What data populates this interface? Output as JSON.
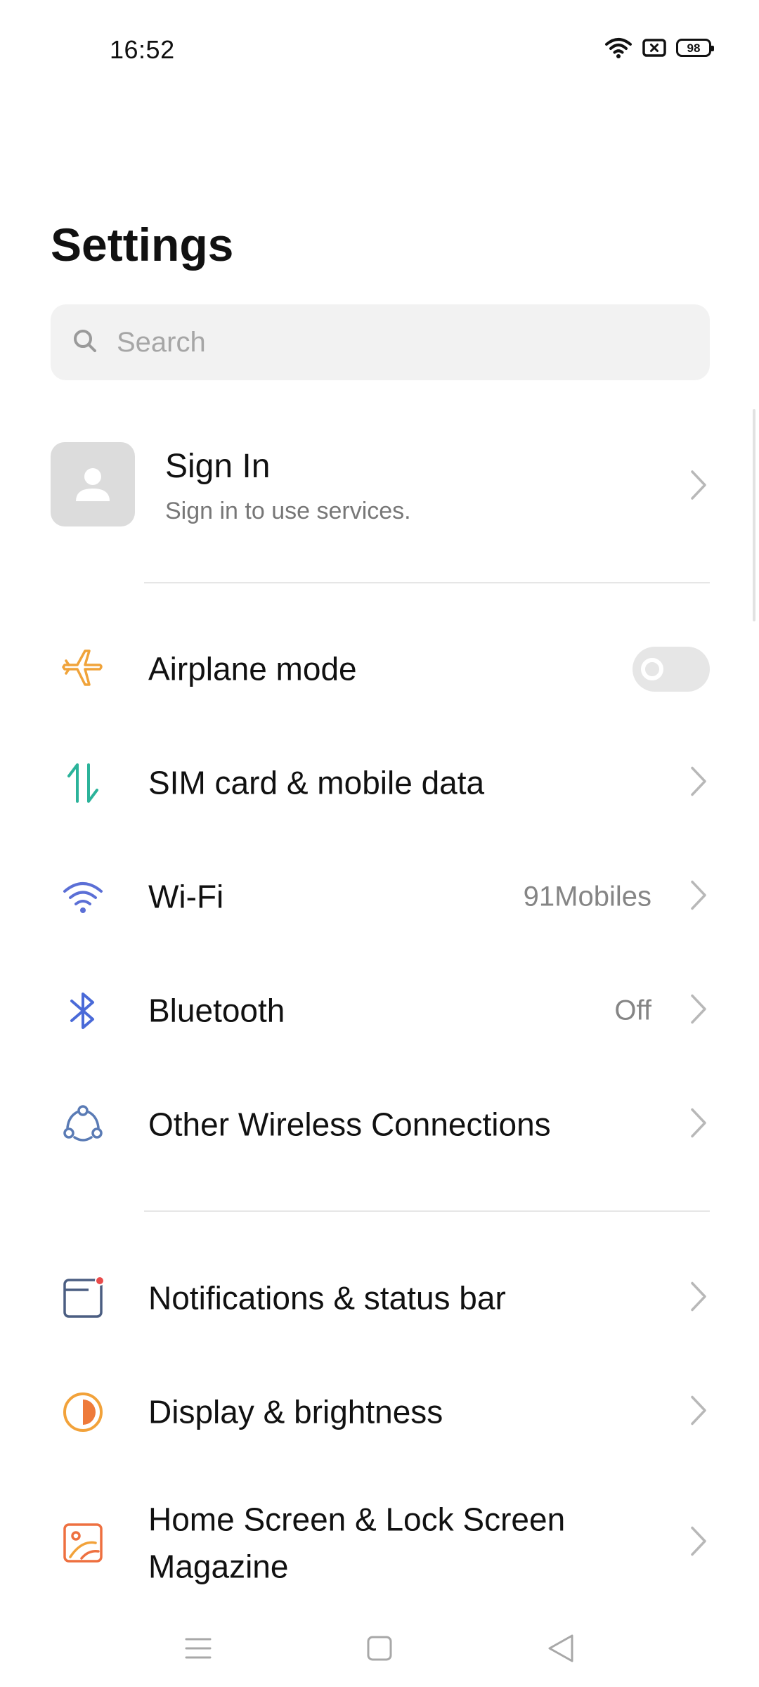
{
  "status_bar": {
    "time": "16:52",
    "battery_level": "98",
    "icons": [
      "wifi-icon",
      "sim-absent-icon",
      "battery-icon"
    ]
  },
  "header": {
    "title": "Settings"
  },
  "search": {
    "placeholder": "Search"
  },
  "account": {
    "title": "Sign In",
    "subtitle": "Sign in to use services."
  },
  "rows": [
    {
      "label": "Airplane mode",
      "icon": "airplane-icon",
      "control": "toggle",
      "toggle_on": false
    },
    {
      "label": "SIM card & mobile data",
      "icon": "mobile-data-icon",
      "control": "chevron"
    },
    {
      "label": "Wi-Fi",
      "icon": "wifi-icon",
      "value": "91Mobiles",
      "control": "chevron"
    },
    {
      "label": "Bluetooth",
      "icon": "bluetooth-icon",
      "value": "Off",
      "control": "chevron"
    },
    {
      "label": "Other Wireless Connections",
      "icon": "wireless-connections-icon",
      "control": "chevron"
    },
    {
      "label": "Notifications & status bar",
      "icon": "notifications-icon",
      "control": "chevron"
    },
    {
      "label": "Display & brightness",
      "icon": "display-brightness-icon",
      "control": "chevron"
    },
    {
      "label": "Home Screen & Lock Screen Magazine",
      "icon": "home-screen-icon",
      "control": "chevron"
    }
  ],
  "nav_bar": {
    "buttons": [
      "menu-icon",
      "home-icon",
      "back-icon"
    ]
  },
  "colors": {
    "airplane": "#f0a33a",
    "mobile_data": "#2bb39a",
    "wifi": "#5b6fd6",
    "bluetooth": "#4a6ad8",
    "wireless": "#5a7bb5",
    "notifications": "#4b5e82",
    "notification_dot": "#e94b4b",
    "display": "#f2a23a",
    "home_screen": "#ee7040",
    "chevron": "#b8b8b8"
  }
}
